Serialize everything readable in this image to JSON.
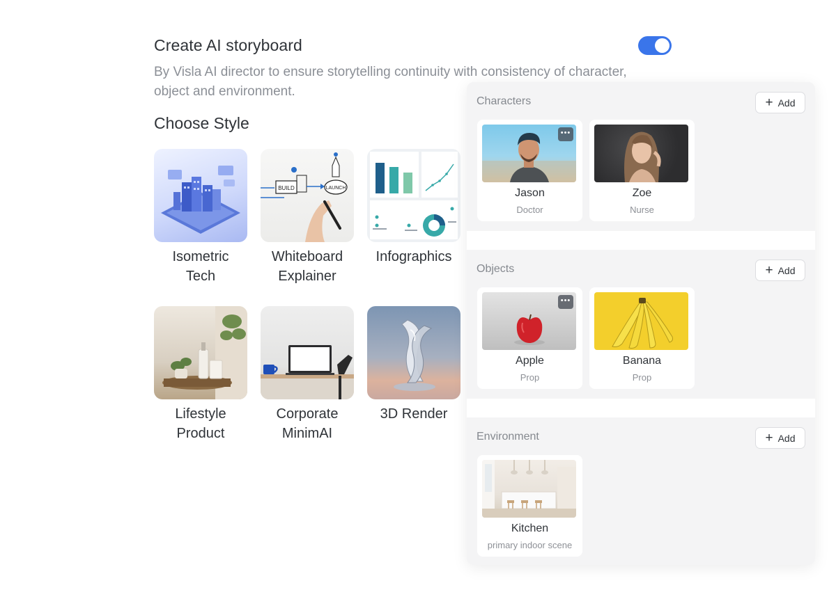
{
  "storyboard": {
    "title": "Create AI storyboard",
    "description": "By Visla AI director to ensure storytelling continuity with consistency of character, object and environment.",
    "toggle_on": true,
    "accent_color": "#3a75ea"
  },
  "styles": {
    "heading": "Choose Style",
    "items": [
      {
        "line1": "Isometric",
        "line2": "Tech"
      },
      {
        "line1": "Whiteboard",
        "line2": "Explainer"
      },
      {
        "line1": "Infographics",
        "line2": ""
      },
      {
        "line1": "Lifestyle",
        "line2": "Product"
      },
      {
        "line1": "Corporate",
        "line2": "MinimAI"
      },
      {
        "line1": "3D Render",
        "line2": ""
      }
    ]
  },
  "whiteboard": {
    "build": "BUILD",
    "launch": "LAUNCH"
  },
  "panel": {
    "add_label": "Add",
    "more_icon": "more-dots-icon",
    "characters": {
      "title": "Characters",
      "items": [
        {
          "name": "Jason",
          "role": "Doctor"
        },
        {
          "name": "Zoe",
          "role": "Nurse"
        }
      ]
    },
    "objects": {
      "title": "Objects",
      "items": [
        {
          "name": "Apple",
          "role": "Prop"
        },
        {
          "name": "Banana",
          "role": "Prop"
        }
      ]
    },
    "environment": {
      "title": "Environment",
      "items": [
        {
          "name": "Kitchen",
          "role": "primary indoor scene"
        }
      ]
    }
  }
}
